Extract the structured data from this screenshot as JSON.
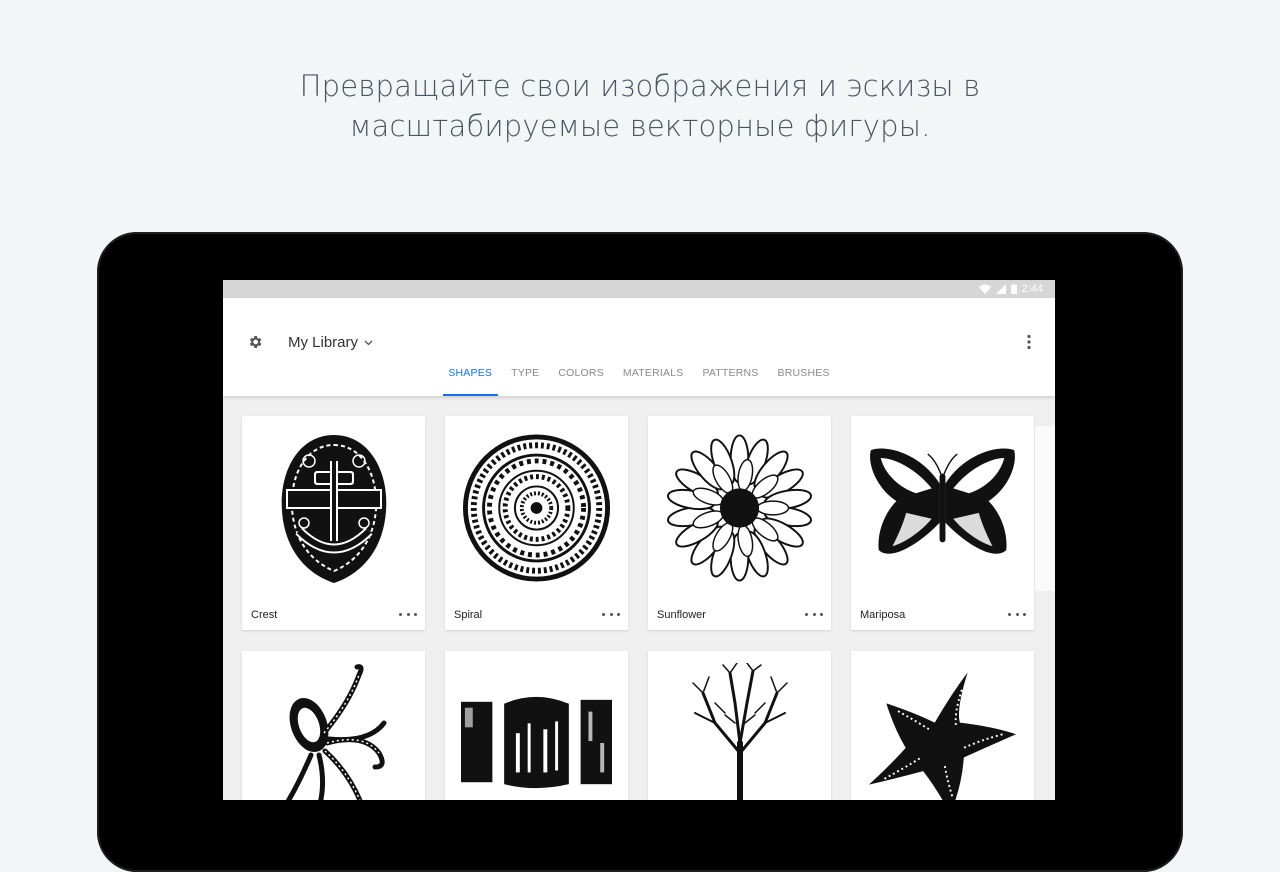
{
  "headline": {
    "line1": "Превращайте свои изображения и эскизы в",
    "line2": "масштабируемые векторные фигуры."
  },
  "status_bar": {
    "time": "2:44"
  },
  "app_bar": {
    "library_title": "My Library",
    "tabs": [
      {
        "label": "SHAPES",
        "active": true
      },
      {
        "label": "TYPE",
        "active": false
      },
      {
        "label": "COLORS",
        "active": false
      },
      {
        "label": "MATERIALS",
        "active": false
      },
      {
        "label": "PATTERNS",
        "active": false
      },
      {
        "label": "BRUSHES",
        "active": false
      }
    ]
  },
  "shapes": [
    {
      "name": "Crest",
      "icon": "crest-shape-icon"
    },
    {
      "name": "Spiral",
      "icon": "spiral-shape-icon"
    },
    {
      "name": "Sunflower",
      "icon": "sunflower-shape-icon"
    },
    {
      "name": "Mariposa",
      "icon": "butterfly-shape-icon"
    },
    {
      "name": "",
      "icon": "octopus-shape-icon"
    },
    {
      "name": "",
      "icon": "brush-blocks-shape-icon"
    },
    {
      "name": "",
      "icon": "tree-shape-icon"
    },
    {
      "name": "",
      "icon": "starfish-shape-icon"
    }
  ],
  "colors": {
    "accent": "#1473e6",
    "background": "#f3f6f7",
    "device": "#000000"
  }
}
